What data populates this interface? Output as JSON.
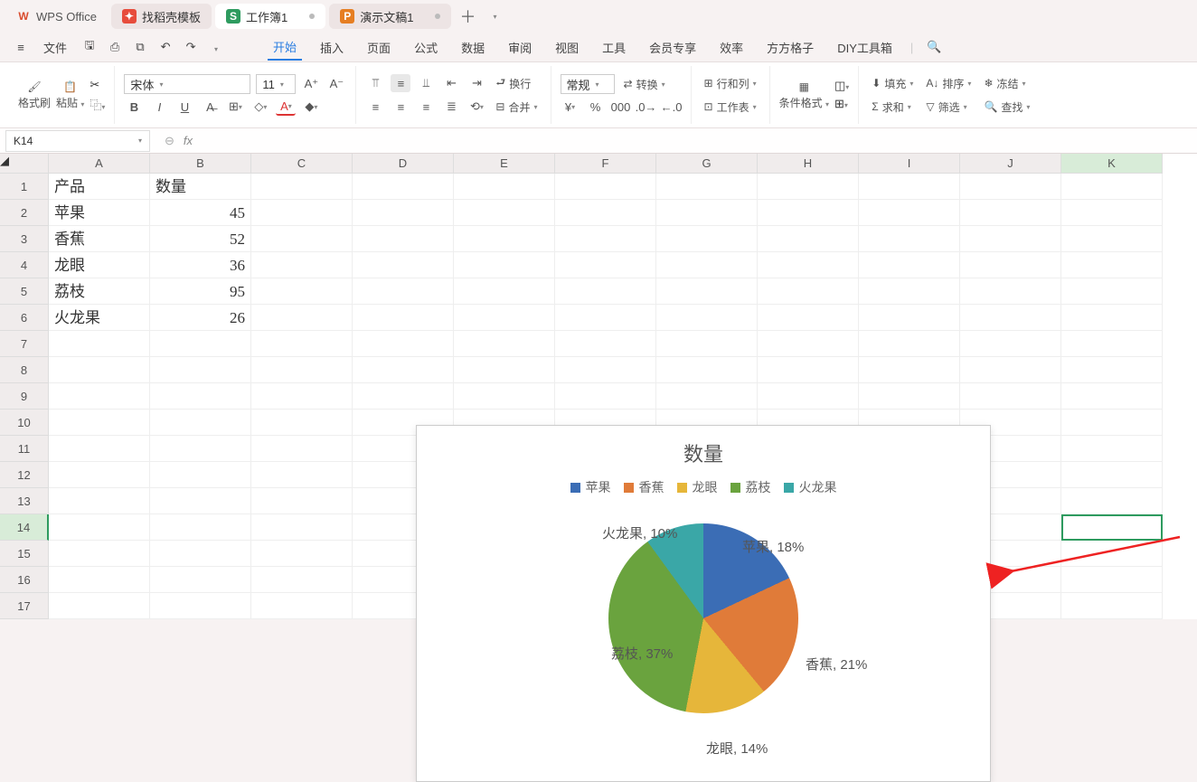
{
  "tabs": {
    "app": "WPS Office",
    "templates": "找稻壳模板",
    "workbook": "工作簿1",
    "presentation": "演示文稿1"
  },
  "menu": {
    "file": "文件",
    "items": [
      "开始",
      "插入",
      "页面",
      "公式",
      "数据",
      "审阅",
      "视图",
      "工具",
      "会员专享",
      "效率",
      "方方格子",
      "DIY工具箱"
    ]
  },
  "ribbon": {
    "formatbrush": "格式刷",
    "paste": "粘贴",
    "font": "宋体",
    "size": "11",
    "wrap": "换行",
    "merge": "合并",
    "general": "常规",
    "convert": "转换",
    "rowcol": "行和列",
    "worksheet": "工作表",
    "conditional": "条件格式",
    "fill": "填充",
    "sum": "求和",
    "sort": "排序",
    "freeze": "冻结",
    "filter": "筛选",
    "find": "查找"
  },
  "namebox": "K14",
  "sheet": {
    "cols": [
      "A",
      "B",
      "C",
      "D",
      "E",
      "F",
      "G",
      "H",
      "I",
      "J",
      "K"
    ],
    "headers": {
      "a": "产品",
      "b": "数量"
    },
    "data": [
      {
        "a": "苹果",
        "b": "45"
      },
      {
        "a": "香蕉",
        "b": "52"
      },
      {
        "a": "龙眼",
        "b": "36"
      },
      {
        "a": "荔枝",
        "b": "95"
      },
      {
        "a": "火龙果",
        "b": "26"
      }
    ]
  },
  "chart_data": {
    "type": "pie",
    "title": "数量",
    "categories": [
      "苹果",
      "香蕉",
      "龙眼",
      "荔枝",
      "火龙果"
    ],
    "values": [
      45,
      52,
      36,
      95,
      26
    ],
    "percent_labels": [
      "苹果, 18%",
      "香蕉, 21%",
      "龙眼, 14%",
      "荔枝, 37%",
      "火龙果, 10%"
    ],
    "colors": [
      "#3b6db5",
      "#e07b39",
      "#e6b63a",
      "#6aa33e",
      "#3aa7a7"
    ]
  }
}
